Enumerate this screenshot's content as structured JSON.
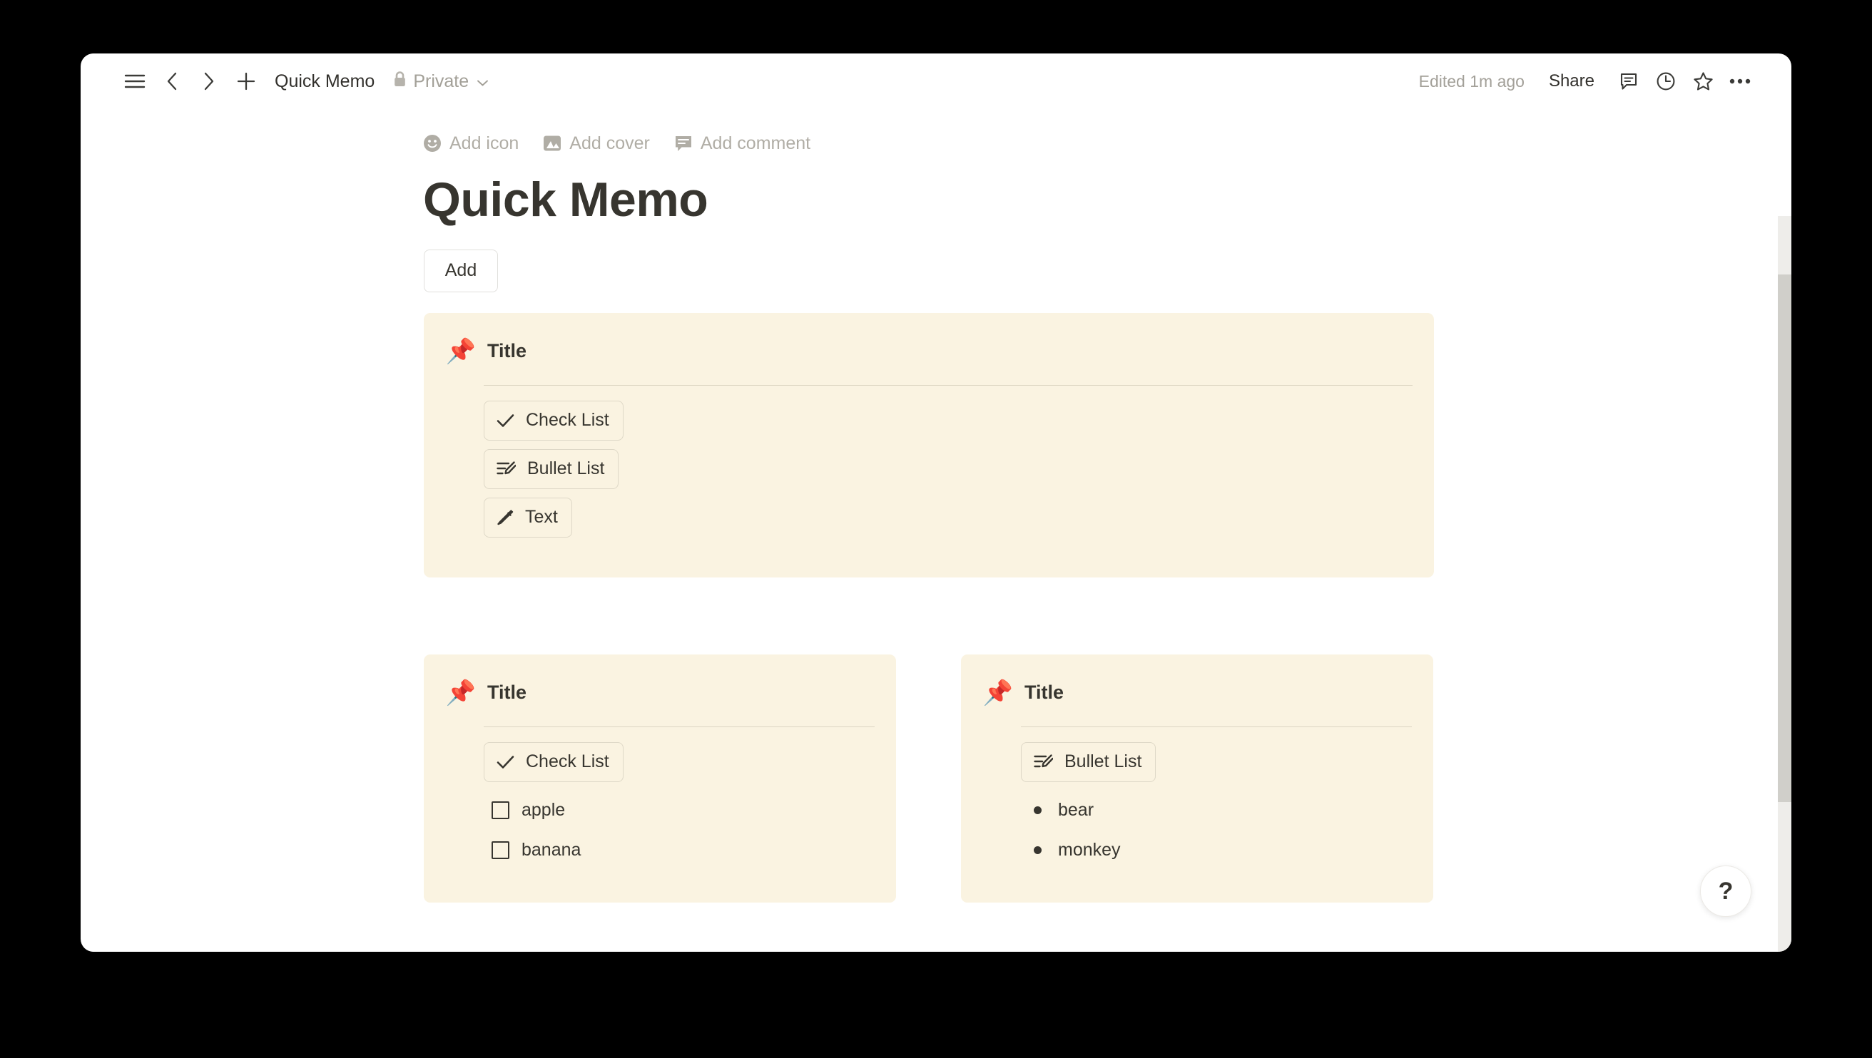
{
  "topbar": {
    "menu_icon": "hamburger-menu-icon",
    "back_icon": "chevron-left-icon",
    "forward_icon": "chevron-right-icon",
    "new_icon": "plus-icon",
    "breadcrumb_title": "Quick Memo",
    "privacy_label": "Private",
    "privacy_icon": "lock-icon",
    "privacy_chevron": "chevron-down-icon",
    "edited_status": "Edited 1m ago",
    "share_label": "Share",
    "comment_icon": "comment-icon",
    "history_icon": "clock-icon",
    "favorite_icon": "star-icon",
    "more_icon": "ellipsis-icon"
  },
  "page": {
    "actions": [
      {
        "label": "Add icon",
        "icon": "smiley-icon"
      },
      {
        "label": "Add cover",
        "icon": "image-icon"
      },
      {
        "label": "Add comment",
        "icon": "comment-icon"
      }
    ],
    "title": "Quick Memo",
    "add_button_label": "Add"
  },
  "cards": [
    {
      "pin_icon": "pushpin-icon",
      "title": "Title",
      "tools": [
        {
          "label": "Check List",
          "icon": "check-icon"
        },
        {
          "label": "Bullet List",
          "icon": "list-edit-icon"
        },
        {
          "label": "Text",
          "icon": "pencil-icon"
        }
      ],
      "items": []
    },
    {
      "pin_icon": "pushpin-icon",
      "title": "Title",
      "tools": [
        {
          "label": "Check List",
          "icon": "check-icon"
        }
      ],
      "items": [
        {
          "type": "checkbox",
          "label": "apple",
          "checked": false
        },
        {
          "type": "checkbox",
          "label": "banana",
          "checked": false
        }
      ]
    },
    {
      "pin_icon": "pushpin-icon",
      "title": "Title",
      "tools": [
        {
          "label": "Bullet List",
          "icon": "list-edit-icon"
        }
      ],
      "items": [
        {
          "type": "bullet",
          "label": "bear"
        },
        {
          "type": "bullet",
          "label": "monkey"
        }
      ]
    }
  ],
  "help": {
    "label": "?"
  },
  "colors": {
    "card_background": "#faf3e1",
    "card_border": "#ded8c7",
    "text": "#37352f",
    "muted_text": "#a3a099",
    "pin_red": "#d9342b"
  }
}
